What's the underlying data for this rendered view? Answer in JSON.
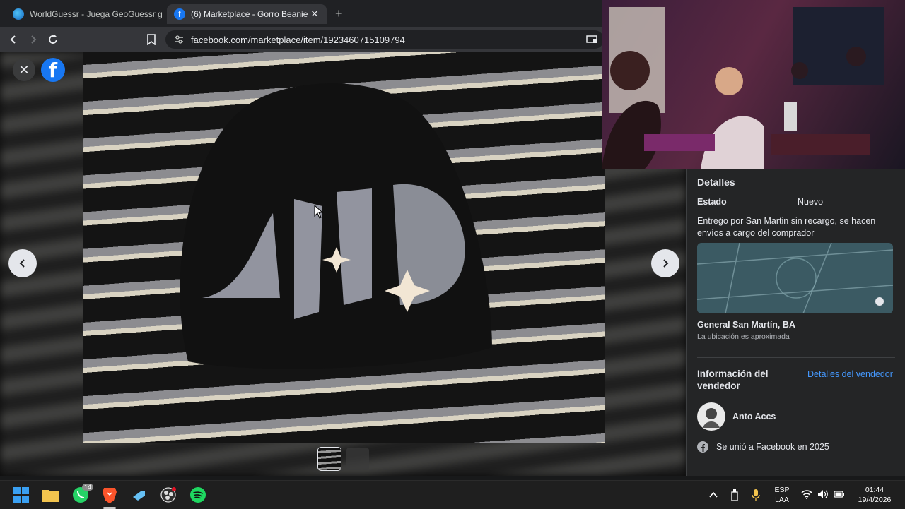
{
  "browser": {
    "tabs": [
      {
        "title": "WorldGuessr - Juega GeoGuessr gratis",
        "favicon": "globe-icon",
        "active": false
      },
      {
        "title": "(6) Marketplace - Gorro Beanie |",
        "favicon": "facebook-icon",
        "active": true
      }
    ],
    "url": "facebook.com/marketplace/item/1923460715109794",
    "close_symbol": "✕",
    "new_tab_symbol": "+"
  },
  "viewer": {
    "close_symbol": "✕",
    "logo_letter": "f",
    "prev_symbol": "‹",
    "next_symbol": "›",
    "thumbnails": [
      "thumbnail-1",
      "thumbnail-2"
    ]
  },
  "details": {
    "heading": "Detalles",
    "condition_label": "Estado",
    "condition_value": "Nuevo",
    "description": "Entrego por San Martin sin recargo, se hacen envíos a cargo del comprador",
    "location": "General San Martín, BA",
    "location_note": "La ubicación es aproximada"
  },
  "seller": {
    "heading": "Información del vendedor",
    "details_link": "Detalles del vendedor",
    "name": "Anto Accs",
    "joined": "Se unió a Facebook en 2025"
  },
  "taskbar": {
    "whatsapp_badge": "14",
    "language_line1": "ESP",
    "language_line2": "LAA",
    "time": "01:44",
    "date": "19/4/2026"
  },
  "colors": {
    "facebook_blue": "#1877f2",
    "link_blue": "#4599ff",
    "panel_bg": "#242526"
  }
}
